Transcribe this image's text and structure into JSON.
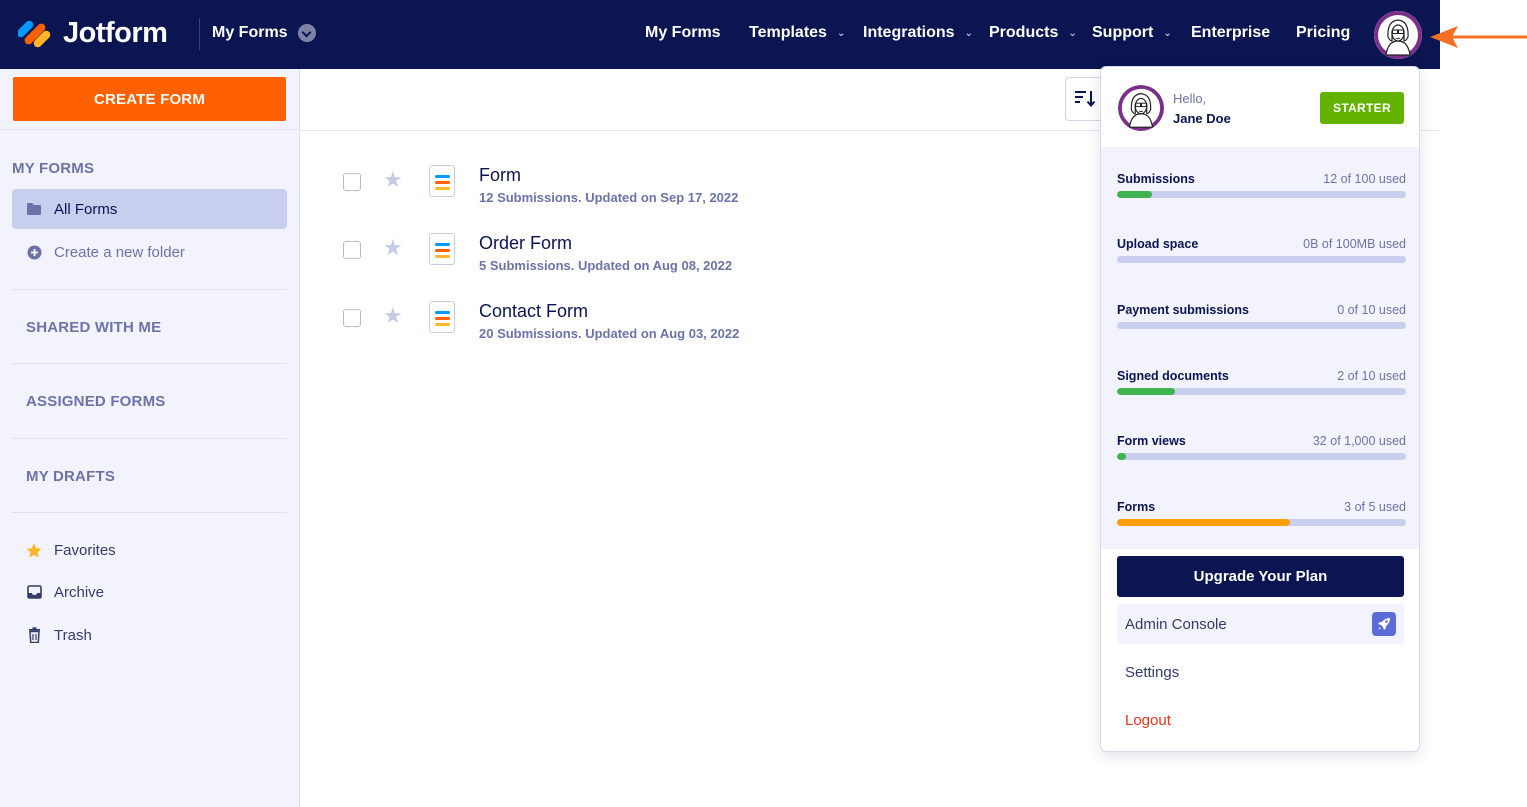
{
  "header": {
    "brand": "Jotform",
    "switcher_label": "My Forms",
    "nav": [
      {
        "label": "My Forms",
        "has_menu": false
      },
      {
        "label": "Templates",
        "has_menu": true
      },
      {
        "label": "Integrations",
        "has_menu": true
      },
      {
        "label": "Products",
        "has_menu": true
      },
      {
        "label": "Support",
        "has_menu": true
      },
      {
        "label": "Enterprise",
        "has_menu": false
      },
      {
        "label": "Pricing",
        "has_menu": false
      }
    ],
    "chevron": "⌄"
  },
  "sidebar": {
    "create_label": "CREATE FORM",
    "my_forms_heading": "MY FORMS",
    "all_forms": "All Forms",
    "new_folder": "Create a new folder",
    "shared": "SHARED WITH ME",
    "assigned": "ASSIGNED FORMS",
    "drafts": "MY DRAFTS",
    "favorites": "Favorites",
    "archive": "Archive",
    "trash": "Trash"
  },
  "forms": [
    {
      "title": "Form",
      "meta": "12 Submissions. Updated on Sep 17, 2022"
    },
    {
      "title": "Order Form",
      "meta": "5 Submissions. Updated on Aug 08, 2022"
    },
    {
      "title": "Contact Form",
      "meta": "20 Submissions. Updated on Aug 03, 2022"
    }
  ],
  "account_menu": {
    "greeting": "Hello,",
    "name": "Jane Doe",
    "plan": "STARTER",
    "usage": [
      {
        "label": "Submissions",
        "value": "12 of 100 used",
        "fraction": 0.12,
        "color": "#3fb34f"
      },
      {
        "label": "Upload space",
        "value": "0B of 100MB used",
        "fraction": 0.0,
        "color": "#3fb34f"
      },
      {
        "label": "Payment submissions",
        "value": "0 of 10 used",
        "fraction": 0.0,
        "color": "#3fb34f"
      },
      {
        "label": "Signed documents",
        "value": "2 of 10 used",
        "fraction": 0.2,
        "color": "#3fb34f"
      },
      {
        "label": "Form views",
        "value": "32 of 1,000 used",
        "fraction": 0.032,
        "color": "#3fb34f"
      },
      {
        "label": "Forms",
        "value": "3 of 5 used",
        "fraction": 0.6,
        "color": "#ff9e00"
      }
    ],
    "upgrade": "Upgrade Your Plan",
    "admin": "Admin Console",
    "settings": "Settings",
    "logout": "Logout"
  },
  "colors": {
    "nav_bg": "#0a1551",
    "accent_orange": "#ff6100",
    "plan_green": "#64b200",
    "logout_red": "#e3341e"
  }
}
